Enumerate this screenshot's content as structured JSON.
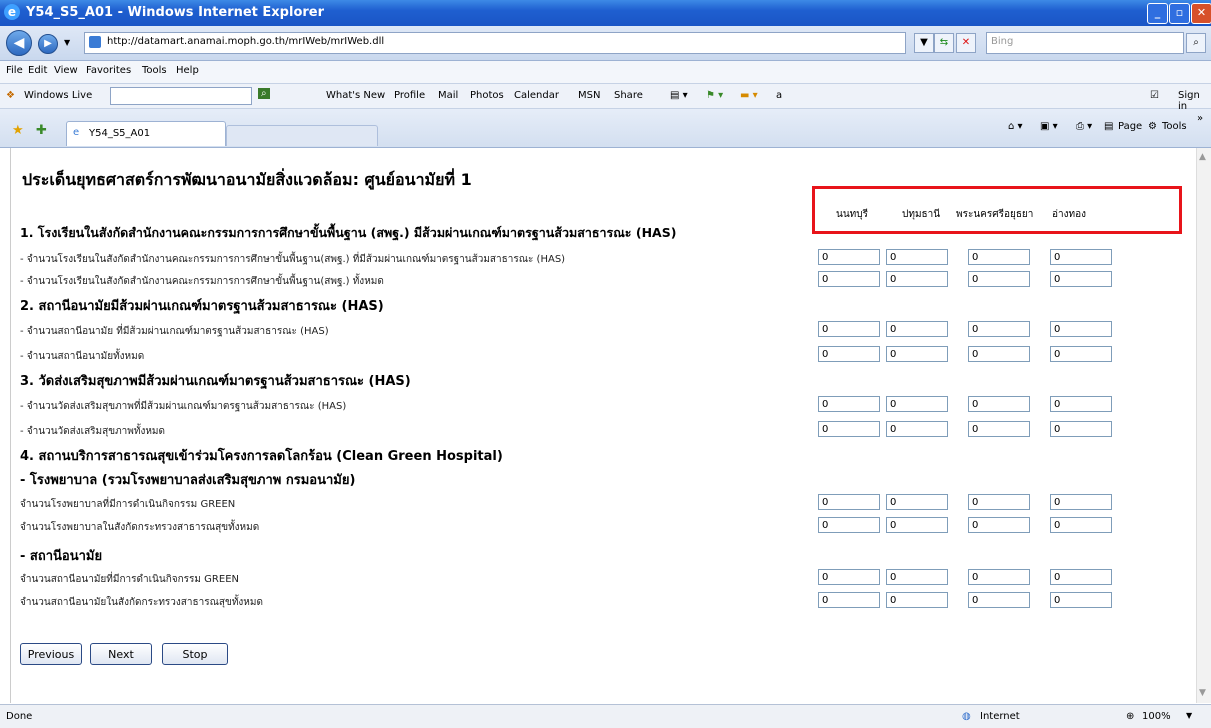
{
  "window": {
    "title": "Y54_S5_A01 - Windows Internet Explorer"
  },
  "address": {
    "url": "http://datamart.anamai.moph.go.th/mrIWeb/mrIWeb.dll",
    "search_placeholder": "Bing"
  },
  "menu": [
    "File",
    "Edit",
    "View",
    "Favorites",
    "Tools",
    "Help"
  ],
  "links": {
    "windows_live": "Windows Live",
    "items": [
      "What's New",
      "Profile",
      "Mail",
      "Photos",
      "Calendar",
      "MSN",
      "Share"
    ],
    "sign_in": "Sign in"
  },
  "tab": {
    "label": "Y54_S5_A01"
  },
  "commandbar": {
    "page": "Page",
    "tools": "Tools"
  },
  "page": {
    "title": "ประเด็นยุทธศาสตร์การพัฒนาอนามัยสิ่งแวดล้อม: ศูนย์อนามัยที่ 1"
  },
  "columns": [
    "นนทบุรี",
    "ปทุมธานี",
    "พระนครศรีอยุธยา",
    "อ่างทอง"
  ],
  "sections": {
    "s1": "1. โรงเรียนในสังกัดสำนักงานคณะกรรมการการศึกษาขั้นพื้นฐาน (สพฐ.) มีส้วมผ่านเกณฑ์มาตรฐานส้วมสาธารณะ (HAS)",
    "s2": "2. สถานีอนามัยมีส้วมผ่านเกณฑ์มาตรฐานส้วมสาธารณะ (HAS)",
    "s3": "3. วัดส่งเสริมสุขภาพมีส้วมผ่านเกณฑ์มาตรฐานส้วมสาธารณะ (HAS)",
    "s4": "4. สถานบริการสาธารณสุขเข้าร่วมโครงการลดโลกร้อน (Clean Green Hospital)",
    "s4a": "- โรงพยาบาล (รวมโรงพยาบาลส่งเสริมสุขภาพ กรมอนามัย)",
    "s4b": "- สถานีอนามัย"
  },
  "rows": [
    "- จำนวนโรงเรียนในสังกัดสำนักงานคณะกรรมการการศึกษาขั้นพื้นฐาน(สพฐ.) ที่มีส้วมผ่านเกณฑ์มาตรฐานส้วมสาธารณะ (HAS)",
    "- จำนวนโรงเรียนในสังกัดสำนักงานคณะกรรมการการศึกษาขั้นพื้นฐาน(สพฐ.) ทั้งหมด",
    "- จำนวนสถานีอนามัย ที่มีส้วมผ่านเกณฑ์มาตรฐานส้วมสาธารณะ (HAS)",
    "- จำนวนสถานีอนามัยทั้งหมด",
    "- จำนวนวัดส่งเสริมสุขภาพที่มีส้วมผ่านเกณฑ์มาตรฐานส้วมสาธารณะ (HAS)",
    "- จำนวนวัดส่งเสริมสุขภาพทั้งหมด",
    "จำนวนโรงพยาบาลที่มีการดำเนินกิจกรรม GREEN",
    "จำนวนโรงพยาบาลในสังกัดกระทรวงสาธารณสุขทั้งหมด",
    "จำนวนสถานีอนามัยที่มีการดำเนินกิจกรรม GREEN",
    "จำนวนสถานีอนามัยในสังกัดกระทรวงสาธารณสุขทั้งหมด"
  ],
  "value": "0",
  "buttons": {
    "previous": "Previous",
    "next": "Next",
    "stop": "Stop"
  },
  "status": {
    "left": "Done",
    "zone": "Internet",
    "zoom": "100%"
  }
}
